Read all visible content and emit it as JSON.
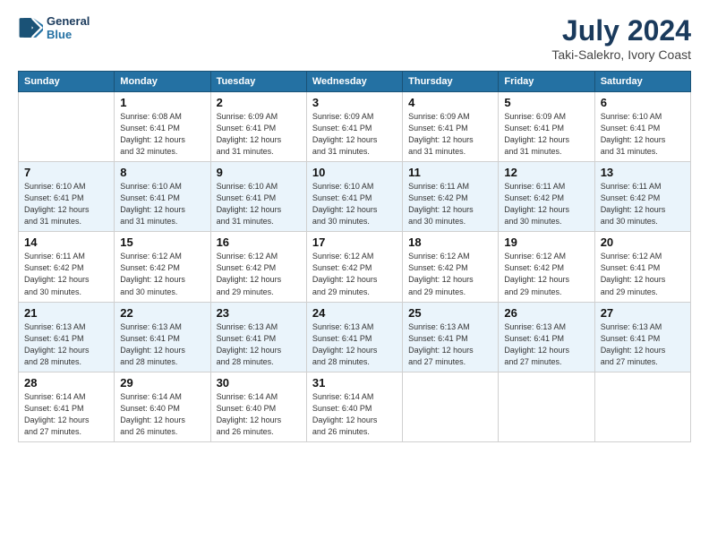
{
  "header": {
    "logo_line1": "General",
    "logo_line2": "Blue",
    "main_title": "July 2024",
    "sub_title": "Taki-Salekro, Ivory Coast"
  },
  "days_of_week": [
    "Sunday",
    "Monday",
    "Tuesday",
    "Wednesday",
    "Thursday",
    "Friday",
    "Saturday"
  ],
  "weeks": [
    [
      {
        "num": "",
        "info": ""
      },
      {
        "num": "1",
        "info": "Sunrise: 6:08 AM\nSunset: 6:41 PM\nDaylight: 12 hours\nand 32 minutes."
      },
      {
        "num": "2",
        "info": "Sunrise: 6:09 AM\nSunset: 6:41 PM\nDaylight: 12 hours\nand 31 minutes."
      },
      {
        "num": "3",
        "info": "Sunrise: 6:09 AM\nSunset: 6:41 PM\nDaylight: 12 hours\nand 31 minutes."
      },
      {
        "num": "4",
        "info": "Sunrise: 6:09 AM\nSunset: 6:41 PM\nDaylight: 12 hours\nand 31 minutes."
      },
      {
        "num": "5",
        "info": "Sunrise: 6:09 AM\nSunset: 6:41 PM\nDaylight: 12 hours\nand 31 minutes."
      },
      {
        "num": "6",
        "info": "Sunrise: 6:10 AM\nSunset: 6:41 PM\nDaylight: 12 hours\nand 31 minutes."
      }
    ],
    [
      {
        "num": "7",
        "info": "Sunrise: 6:10 AM\nSunset: 6:41 PM\nDaylight: 12 hours\nand 31 minutes."
      },
      {
        "num": "8",
        "info": "Sunrise: 6:10 AM\nSunset: 6:41 PM\nDaylight: 12 hours\nand 31 minutes."
      },
      {
        "num": "9",
        "info": "Sunrise: 6:10 AM\nSunset: 6:41 PM\nDaylight: 12 hours\nand 31 minutes."
      },
      {
        "num": "10",
        "info": "Sunrise: 6:10 AM\nSunset: 6:41 PM\nDaylight: 12 hours\nand 30 minutes."
      },
      {
        "num": "11",
        "info": "Sunrise: 6:11 AM\nSunset: 6:42 PM\nDaylight: 12 hours\nand 30 minutes."
      },
      {
        "num": "12",
        "info": "Sunrise: 6:11 AM\nSunset: 6:42 PM\nDaylight: 12 hours\nand 30 minutes."
      },
      {
        "num": "13",
        "info": "Sunrise: 6:11 AM\nSunset: 6:42 PM\nDaylight: 12 hours\nand 30 minutes."
      }
    ],
    [
      {
        "num": "14",
        "info": "Sunrise: 6:11 AM\nSunset: 6:42 PM\nDaylight: 12 hours\nand 30 minutes."
      },
      {
        "num": "15",
        "info": "Sunrise: 6:12 AM\nSunset: 6:42 PM\nDaylight: 12 hours\nand 30 minutes."
      },
      {
        "num": "16",
        "info": "Sunrise: 6:12 AM\nSunset: 6:42 PM\nDaylight: 12 hours\nand 29 minutes."
      },
      {
        "num": "17",
        "info": "Sunrise: 6:12 AM\nSunset: 6:42 PM\nDaylight: 12 hours\nand 29 minutes."
      },
      {
        "num": "18",
        "info": "Sunrise: 6:12 AM\nSunset: 6:42 PM\nDaylight: 12 hours\nand 29 minutes."
      },
      {
        "num": "19",
        "info": "Sunrise: 6:12 AM\nSunset: 6:42 PM\nDaylight: 12 hours\nand 29 minutes."
      },
      {
        "num": "20",
        "info": "Sunrise: 6:12 AM\nSunset: 6:41 PM\nDaylight: 12 hours\nand 29 minutes."
      }
    ],
    [
      {
        "num": "21",
        "info": "Sunrise: 6:13 AM\nSunset: 6:41 PM\nDaylight: 12 hours\nand 28 minutes."
      },
      {
        "num": "22",
        "info": "Sunrise: 6:13 AM\nSunset: 6:41 PM\nDaylight: 12 hours\nand 28 minutes."
      },
      {
        "num": "23",
        "info": "Sunrise: 6:13 AM\nSunset: 6:41 PM\nDaylight: 12 hours\nand 28 minutes."
      },
      {
        "num": "24",
        "info": "Sunrise: 6:13 AM\nSunset: 6:41 PM\nDaylight: 12 hours\nand 28 minutes."
      },
      {
        "num": "25",
        "info": "Sunrise: 6:13 AM\nSunset: 6:41 PM\nDaylight: 12 hours\nand 27 minutes."
      },
      {
        "num": "26",
        "info": "Sunrise: 6:13 AM\nSunset: 6:41 PM\nDaylight: 12 hours\nand 27 minutes."
      },
      {
        "num": "27",
        "info": "Sunrise: 6:13 AM\nSunset: 6:41 PM\nDaylight: 12 hours\nand 27 minutes."
      }
    ],
    [
      {
        "num": "28",
        "info": "Sunrise: 6:14 AM\nSunset: 6:41 PM\nDaylight: 12 hours\nand 27 minutes."
      },
      {
        "num": "29",
        "info": "Sunrise: 6:14 AM\nSunset: 6:40 PM\nDaylight: 12 hours\nand 26 minutes."
      },
      {
        "num": "30",
        "info": "Sunrise: 6:14 AM\nSunset: 6:40 PM\nDaylight: 12 hours\nand 26 minutes."
      },
      {
        "num": "31",
        "info": "Sunrise: 6:14 AM\nSunset: 6:40 PM\nDaylight: 12 hours\nand 26 minutes."
      },
      {
        "num": "",
        "info": ""
      },
      {
        "num": "",
        "info": ""
      },
      {
        "num": "",
        "info": ""
      }
    ]
  ]
}
